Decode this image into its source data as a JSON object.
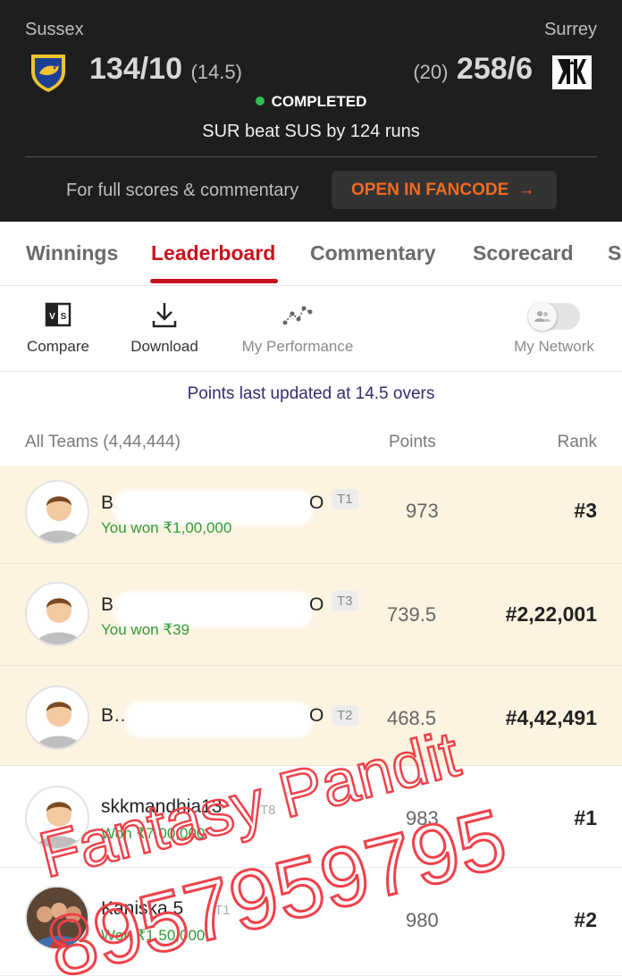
{
  "match": {
    "team1": {
      "name": "Sussex",
      "score": "134/10",
      "overs": "(14.5)"
    },
    "team2": {
      "name": "Surrey",
      "score": "258/6",
      "overs": "(20)"
    },
    "status": "COMPLETED",
    "result": "SUR beat SUS by 124 runs",
    "full_scores_text": "For full scores & commentary",
    "fancode_button": "OPEN IN FANCODE",
    "fancode_arrow": "→"
  },
  "tabs": [
    "Winnings",
    "Leaderboard",
    "Commentary",
    "Scorecard",
    "St"
  ],
  "active_tab": "Leaderboard",
  "toolbar": {
    "compare": "Compare",
    "download": "Download",
    "my_performance": "My Performance",
    "my_network": "My Network"
  },
  "updated_text": "Points last updated at 14.5 overs",
  "list_header": {
    "teams": "All Teams (4,44,444)",
    "points": "Points",
    "rank": "Rank"
  },
  "rows": [
    {
      "name": "B…",
      "name_end": "O",
      "tag": "T1",
      "won": "You won ₹1,00,000",
      "points": "973",
      "rank": "#3"
    },
    {
      "name": "B…",
      "name_end": "O",
      "tag": "T3",
      "won": "You won ₹39",
      "points": "739.5",
      "rank": "#2,22,001"
    },
    {
      "name": "B…",
      "name_end": "O",
      "tag": "T2",
      "won": "",
      "points": "468.5",
      "rank": "#4,42,491"
    },
    {
      "name": "skkmandhia13",
      "tag": "T8",
      "won": "Won ₹7,00,000",
      "points": "983",
      "rank": "#1"
    },
    {
      "name": "Kaniska 5",
      "tag": "T1",
      "won": "Won ₹1,50,000",
      "points": "980",
      "rank": "#2"
    }
  ],
  "watermark": {
    "line1": "Fantasy Pandit",
    "line2": "8957959795",
    "color": "#f0414a"
  },
  "colors": {
    "accent": "#c8131e",
    "fancode": "#f26a21",
    "win_green": "#2f9b3a",
    "header_bg": "#1e1e1e"
  }
}
